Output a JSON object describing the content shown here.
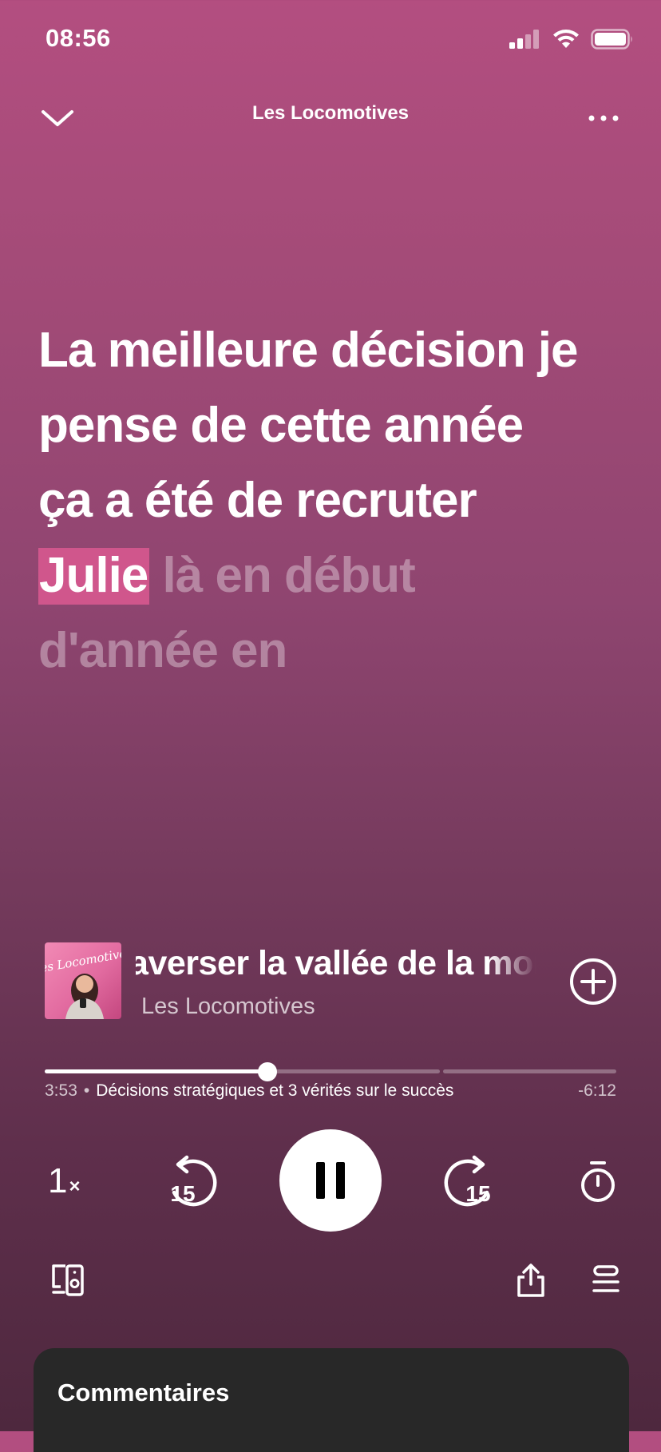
{
  "status_bar": {
    "time": "08:56",
    "icons": [
      "cellular-signal-icon",
      "wifi-icon",
      "battery-icon"
    ]
  },
  "header": {
    "title": "Les Locomotives",
    "collapse_icon": "chevron-down-icon",
    "more_icon": "more-horizontal-icon"
  },
  "lyrics": {
    "lines": [
      {
        "sung": "La meilleure décision je"
      },
      {
        "sung": "pense de cette année"
      },
      {
        "sung": "ça a été de recruter"
      },
      {
        "current_word": "Julie",
        "upcoming": "là en début"
      },
      {
        "upcoming": "d'année en"
      }
    ]
  },
  "now_playing": {
    "cover_text": "Les Locomotives",
    "episode_title_visible": "traverser la vallée de la mor",
    "show_name": "Les Locomotives",
    "add_icon": "add-circle-icon"
  },
  "playback": {
    "elapsed": "3:53",
    "chapter": "Décisions stratégiques et 3 vérités sur le succès",
    "remaining": "-6:12",
    "progress_fraction": 0.39,
    "speed_number": "1",
    "speed_suffix": "×",
    "skip_back_seconds": "15",
    "skip_forward_seconds": "15",
    "state": "playing"
  },
  "actions": {
    "connect_icon": "devices-icon",
    "share_icon": "share-icon",
    "queue_icon": "queue-icon",
    "timer_icon": "sleep-timer-icon"
  },
  "comments": {
    "title": "Commentaires"
  },
  "colors": {
    "background_top": "#b34e80",
    "background_bottom": "#4e283e",
    "lyric_highlight": "#d0568c",
    "comments_panel": "#282828"
  }
}
